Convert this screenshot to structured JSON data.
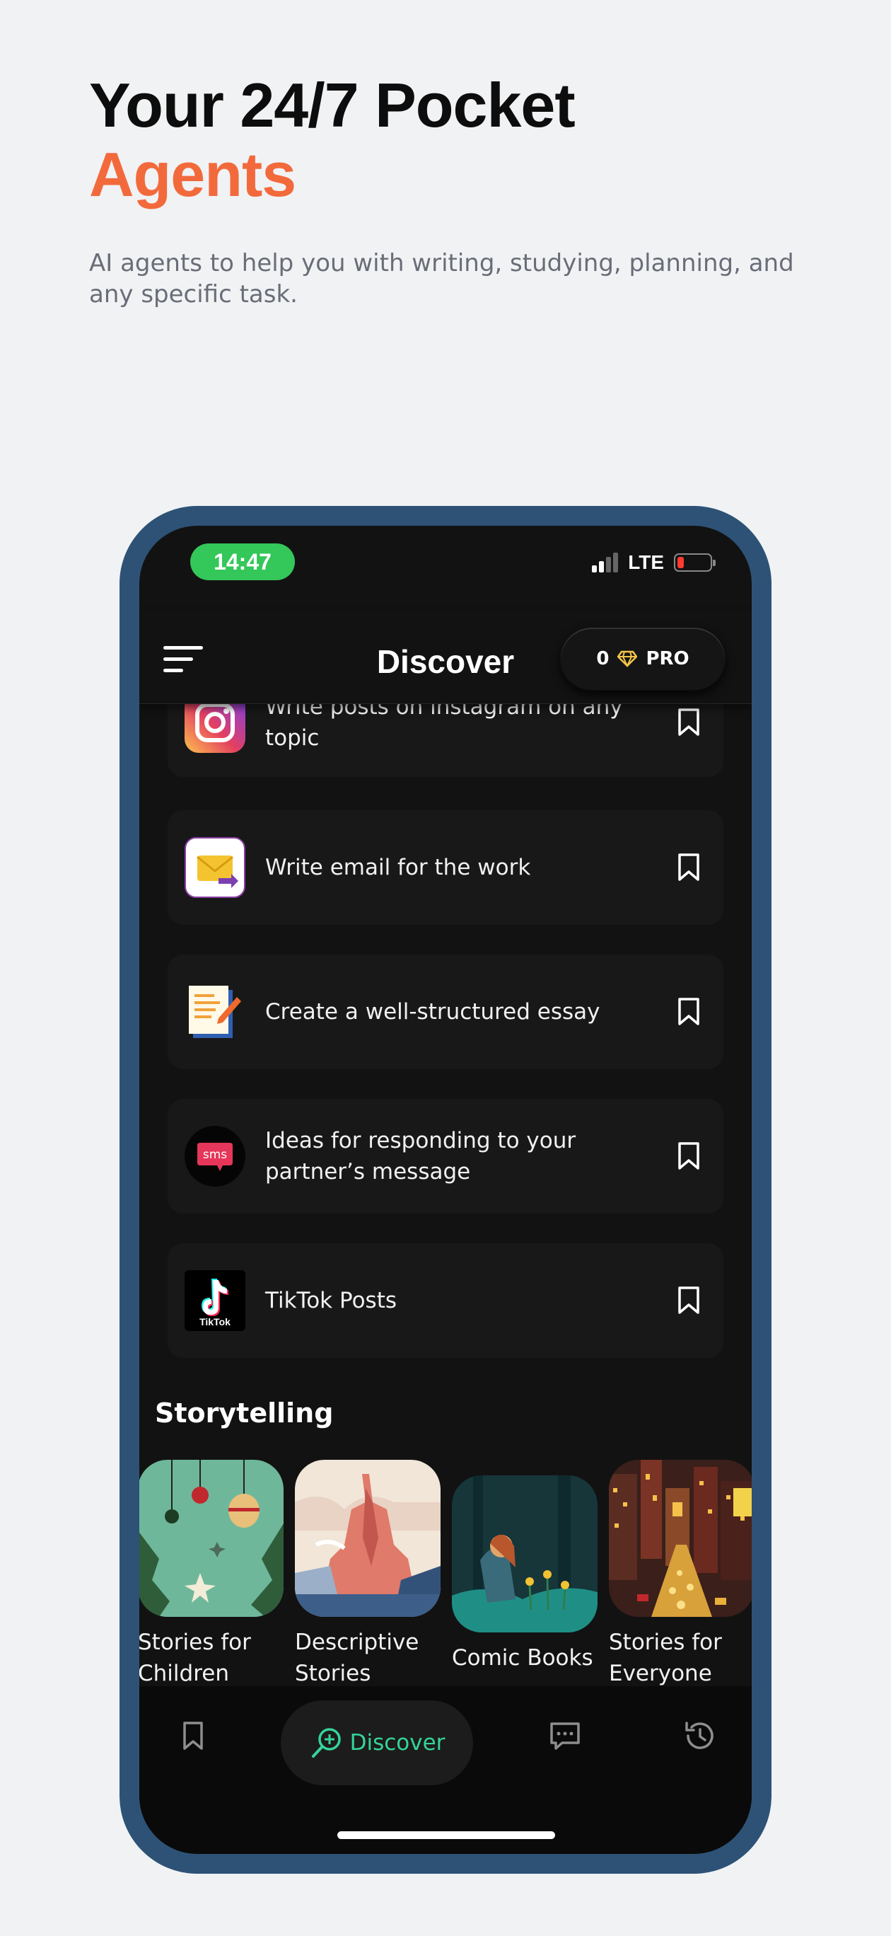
{
  "hero": {
    "title_line1": "Your 24/7 Pocket",
    "title_line2": "Agents",
    "subtitle": "AI agents to help you with writing, studying, planning, and any specific task."
  },
  "status_bar": {
    "time": "14:47",
    "network": "LTE"
  },
  "header": {
    "title": "Discover",
    "credits": "0",
    "pro_label": "PRO"
  },
  "cards": [
    {
      "text": "Write posts on instagram on any topic",
      "icon": "instagram-icon"
    },
    {
      "text": "Write email for the work",
      "icon": "email-icon"
    },
    {
      "text": "Create a well-structured essay",
      "icon": "document-icon"
    },
    {
      "text": "Ideas for responding to your partner’s message",
      "icon": "sms-icon",
      "icon_text": "sms"
    },
    {
      "text": "TikTok Posts",
      "icon": "tiktok-icon",
      "icon_text": "TikTok"
    }
  ],
  "storytelling": {
    "title": "Storytelling",
    "items": [
      {
        "label": "Stories for Children"
      },
      {
        "label": "Descriptive Stories"
      },
      {
        "label": "Comic Books"
      },
      {
        "label": "Stories for Everyone"
      }
    ]
  },
  "bottom_nav": {
    "active_label": "Discover"
  },
  "colors": {
    "accent": "#f26a3c",
    "nav_active": "#35d39a",
    "phone_frame": "#2d5276",
    "status_green": "#34c759"
  }
}
